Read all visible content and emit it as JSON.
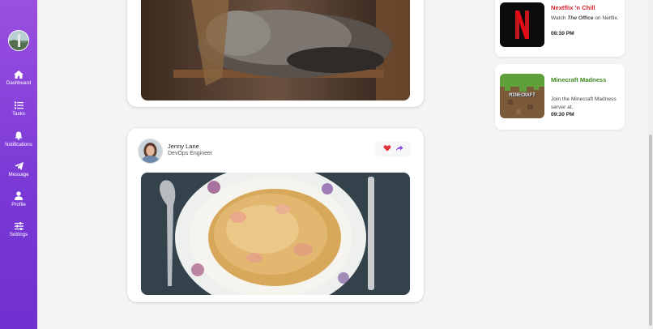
{
  "sidebar": {
    "items": [
      {
        "label": "Dashboard",
        "icon": "home-icon"
      },
      {
        "label": "Tasks",
        "icon": "tasks-icon"
      },
      {
        "label": "Notifications",
        "icon": "bell-icon"
      },
      {
        "label": "Message",
        "icon": "paper-plane-icon"
      },
      {
        "label": "Profile",
        "icon": "user-icon"
      },
      {
        "label": "Settings",
        "icon": "sliders-icon"
      }
    ]
  },
  "post2": {
    "author_name": "Jenny Lane",
    "author_role": "DevOps Engineer"
  },
  "events": [
    {
      "title": "Nextflix 'n Chill",
      "desc_prefix": "Watch ",
      "desc_emphasis": "The Office",
      "desc_suffix": " on Netflix.",
      "time": "08:30 PM",
      "logo": "N"
    },
    {
      "title": "Minecraft Madness",
      "desc": "Join the Minecraft Madness server at.",
      "time": "09:30 PM",
      "logo": "MINECRAFT"
    }
  ],
  "colors": {
    "sidebar": "#8a45dc",
    "netflix_red": "#d0242b",
    "minecraft_green": "#3d8a1d",
    "heart": "#e0303a",
    "share": "#8a45dc"
  }
}
